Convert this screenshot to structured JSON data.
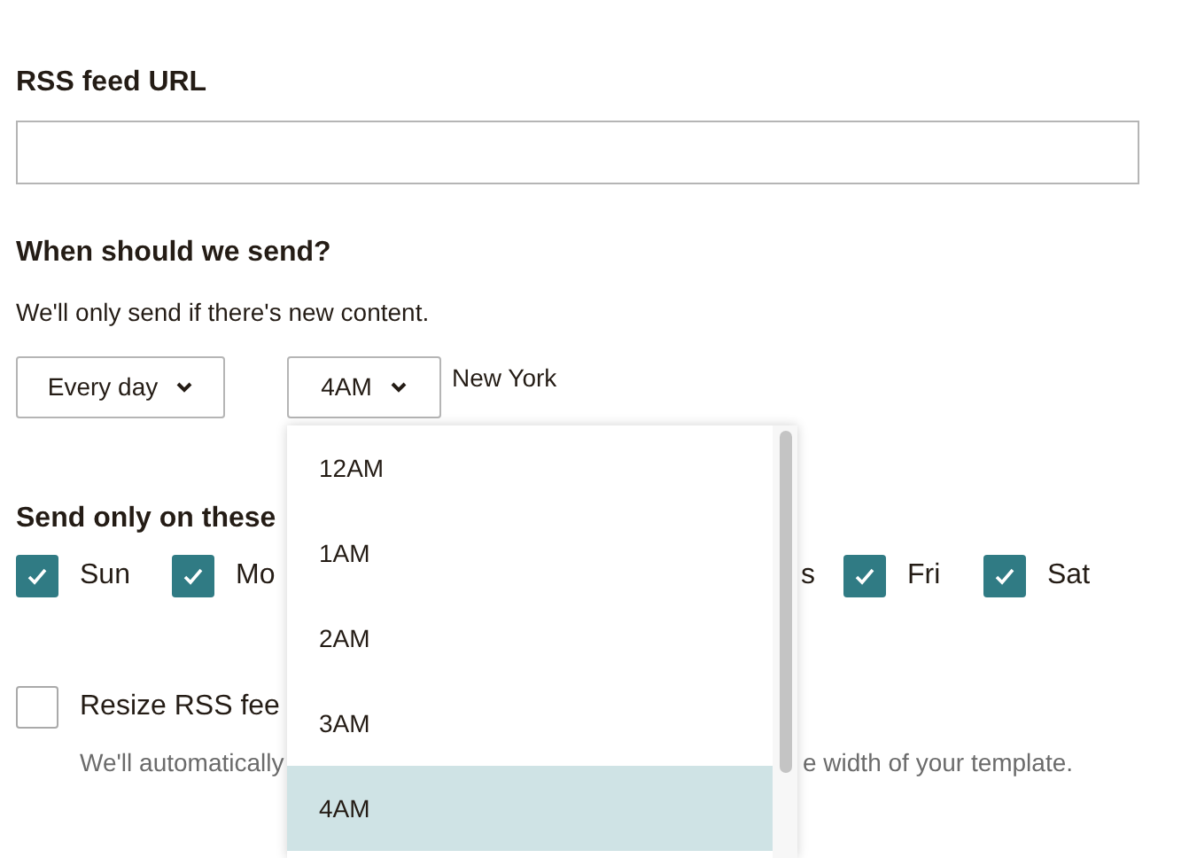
{
  "rss_feed": {
    "label": "RSS feed URL"
  },
  "schedule": {
    "heading": "When should we send?",
    "note": "We'll only send if there's new content.",
    "frequency": {
      "value": "Every day"
    },
    "time": {
      "value": "4AM",
      "expanded": true
    },
    "timezone": "New York"
  },
  "days": {
    "heading": "Send only on these",
    "items": [
      {
        "label": "Sun",
        "checked": true
      },
      {
        "label": "Mo",
        "checked": true
      },
      {
        "label": "Fri",
        "checked": true
      },
      {
        "label": "Sat",
        "checked": true
      }
    ],
    "fragment": "s"
  },
  "resize": {
    "label": "Resize RSS fee",
    "checked": false,
    "hint_start": "We'll automatically",
    "hint_end": "e width of your template."
  },
  "time_options": [
    {
      "label": "12AM",
      "selected": false
    },
    {
      "label": "1AM",
      "selected": false
    },
    {
      "label": "2AM",
      "selected": false
    },
    {
      "label": "3AM",
      "selected": false
    },
    {
      "label": "4AM",
      "selected": true
    }
  ]
}
